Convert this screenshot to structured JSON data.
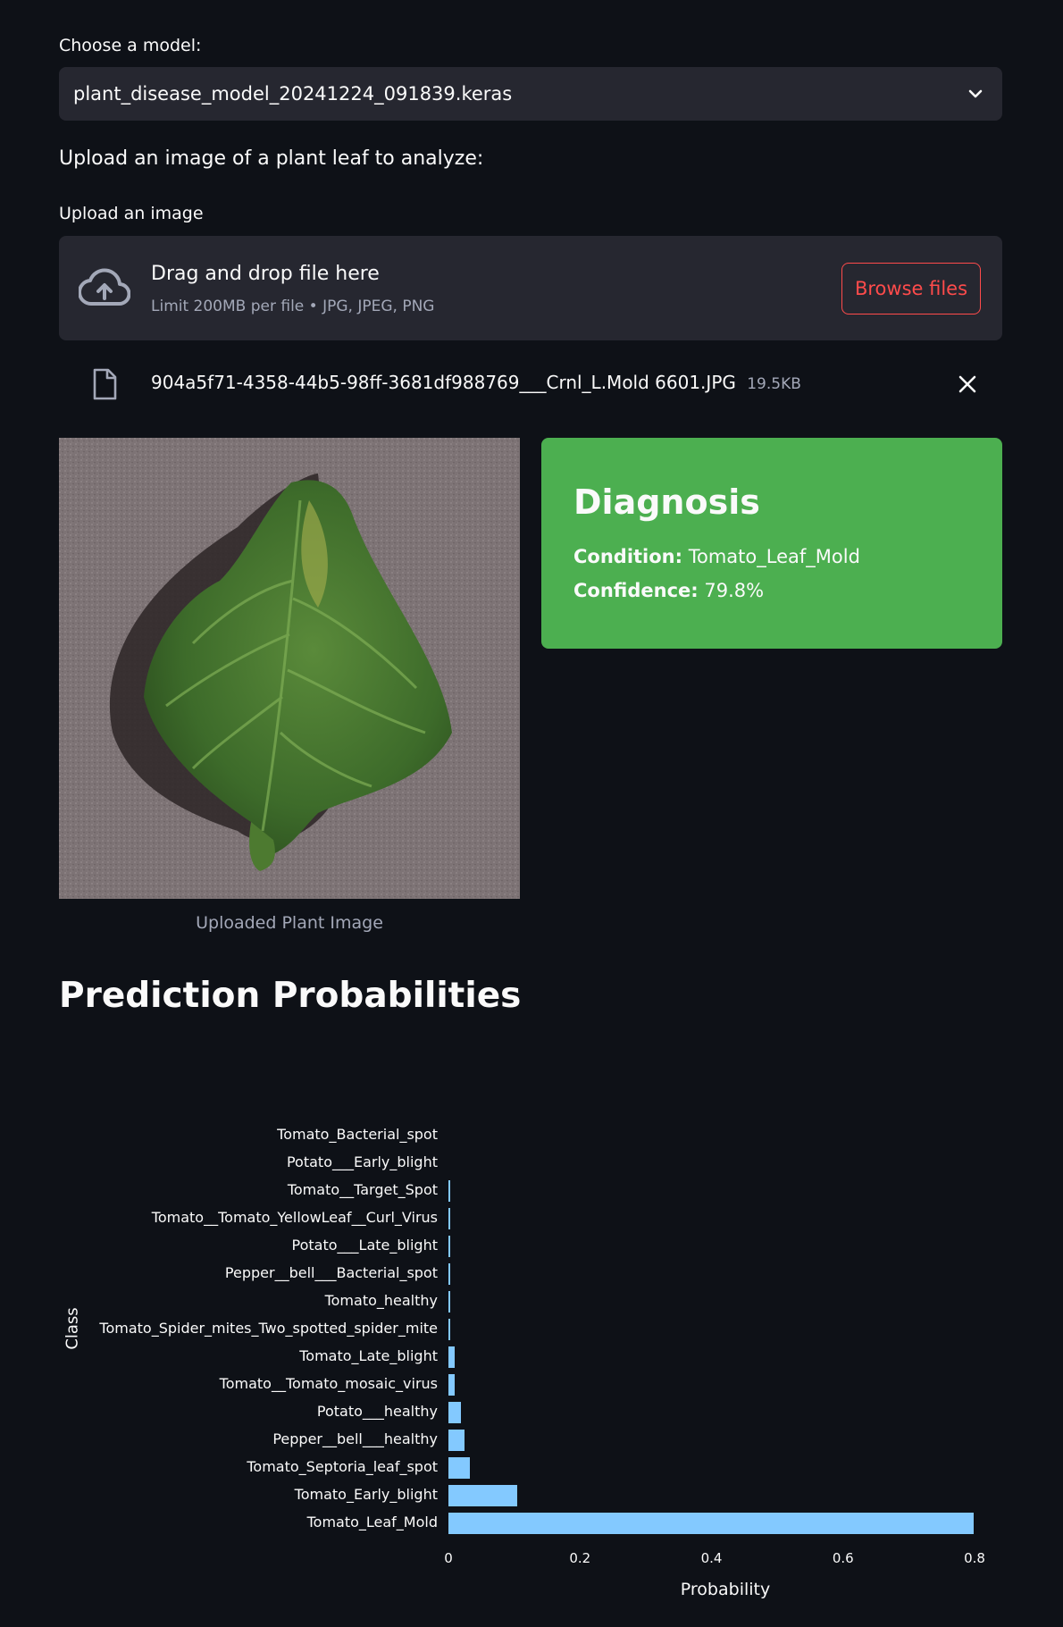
{
  "model": {
    "label": "Choose a model:",
    "selected": "plant_disease_model_20241224_091839.keras"
  },
  "upload_prompt": "Upload an image of a plant leaf to analyze:",
  "uploader": {
    "label": "Upload an image",
    "drag_text": "Drag and drop file here",
    "limit_text": "Limit 200MB per file • JPG, JPEG, PNG",
    "browse_label": "Browse files"
  },
  "file": {
    "name": "904a5f71-4358-44b5-98ff-3681df988769___Crnl_L.Mold 6601.JPG",
    "size": "19.5KB"
  },
  "image_caption": "Uploaded Plant Image",
  "diagnosis": {
    "title": "Diagnosis",
    "condition_label": "Condition:",
    "condition_value": "Tomato_Leaf_Mold",
    "confidence_label": "Confidence:",
    "confidence_value": "79.8%"
  },
  "section_title": "Prediction Probabilities",
  "colors": {
    "bar": "#83c9ff",
    "diagnosis_bg": "#4caf50",
    "accent": "#ff4b4b"
  },
  "chart_data": {
    "type": "bar",
    "orientation": "horizontal",
    "xlabel": "Probability",
    "ylabel": "Class",
    "xlim": [
      0,
      0.8
    ],
    "xticks": [
      "0",
      "0.2",
      "0.4",
      "0.6",
      "0.8"
    ],
    "categories": [
      "Tomato_Bacterial_spot",
      "Potato___Early_blight",
      "Tomato__Target_Spot",
      "Tomato__Tomato_YellowLeaf__Curl_Virus",
      "Potato___Late_blight",
      "Pepper__bell___Bacterial_spot",
      "Tomato_healthy",
      "Tomato_Spider_mites_Two_spotted_spider_mite",
      "Tomato_Late_blight",
      "Tomato__Tomato_mosaic_virus",
      "Potato___healthy",
      "Pepper__bell___healthy",
      "Tomato_Septoria_leaf_spot",
      "Tomato_Early_blight",
      "Tomato_Leaf_Mold"
    ],
    "values": [
      0.0,
      0.0,
      0.002,
      0.002,
      0.002,
      0.002,
      0.002,
      0.002,
      0.009,
      0.01,
      0.019,
      0.024,
      0.033,
      0.105,
      0.798
    ]
  }
}
